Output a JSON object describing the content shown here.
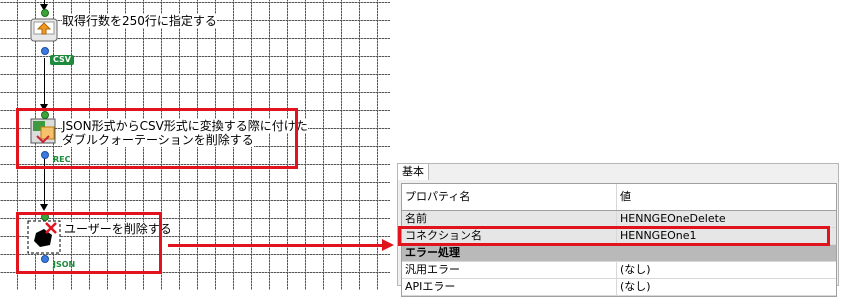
{
  "flow": {
    "node1": {
      "label": "取得行数を250行に指定する",
      "tag": "CSV"
    },
    "node2": {
      "label_line1": "JSON形式からCSV形式に変換する際に付けた",
      "label_line2": "ダブルクォーテーションを削除する",
      "tag": "REC"
    },
    "node3": {
      "label": "ユーザーを削除する",
      "tag": "JSON"
    }
  },
  "properties": {
    "tab": "基本",
    "columns": [
      "プロパティ名",
      "値"
    ],
    "rows": [
      {
        "name": "名前",
        "value": "HENNGEOneDelete"
      },
      {
        "name": "コネクション名",
        "value": "HENNGEOne1"
      }
    ],
    "section": "エラー処理",
    "error_rows": [
      {
        "name": "汎用エラー",
        "value": "(なし)"
      },
      {
        "name": "APIエラー",
        "value": "(なし)"
      }
    ]
  },
  "colors": {
    "highlight": "#e1141d",
    "tag_green": "#1e8a3c"
  }
}
